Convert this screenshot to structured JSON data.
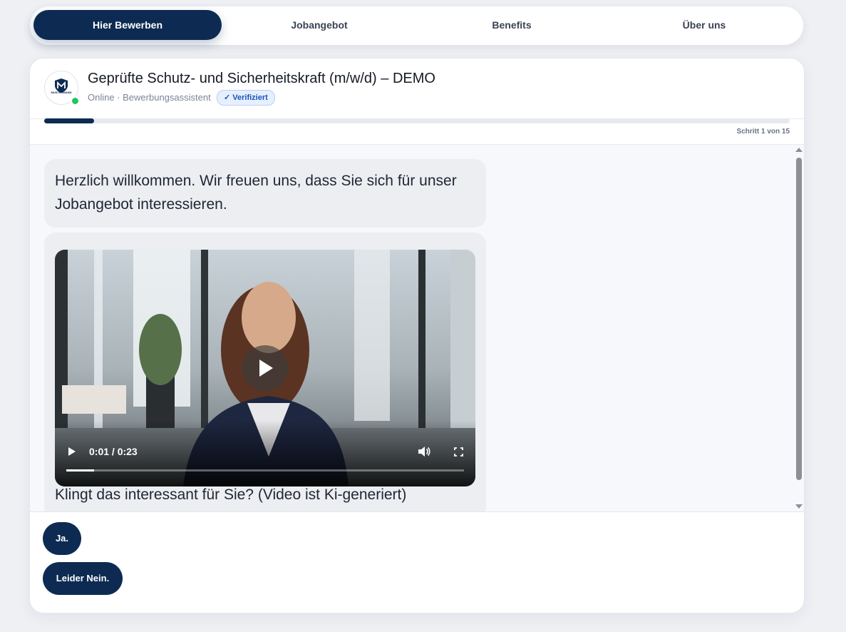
{
  "nav": {
    "tabs": [
      {
        "label": "Hier Bewerben"
      },
      {
        "label": "Jobangebot"
      },
      {
        "label": "Benefits"
      },
      {
        "label": "Über uns"
      }
    ]
  },
  "header": {
    "logo_text": "MUSTERMANN",
    "title": "Geprüfte Schutz- und Sicherheitskraft (m/w/d) – DEMO",
    "subtitle": "Online · Bewerbungsassistent",
    "badge": "✓ Verifiziert"
  },
  "progress": {
    "current": 1,
    "total": 15,
    "label": "Schritt 1 von 15"
  },
  "chat": {
    "message1": "Herzlich willkommen. Wir freuen uns, dass Sie sich für unser Jobangebot interessieren.",
    "video": {
      "time": "0:01 / 0:23",
      "played_fraction": 0.07
    },
    "caption": "Klingt das interessant für Sie? (Video ist Ki-generiert)"
  },
  "replies": [
    {
      "label": "Ja."
    },
    {
      "label": "Leider Nein."
    }
  ],
  "colors": {
    "primary": "#0d2b52",
    "online": "#22c55e",
    "badge_text": "#1c55b8"
  }
}
